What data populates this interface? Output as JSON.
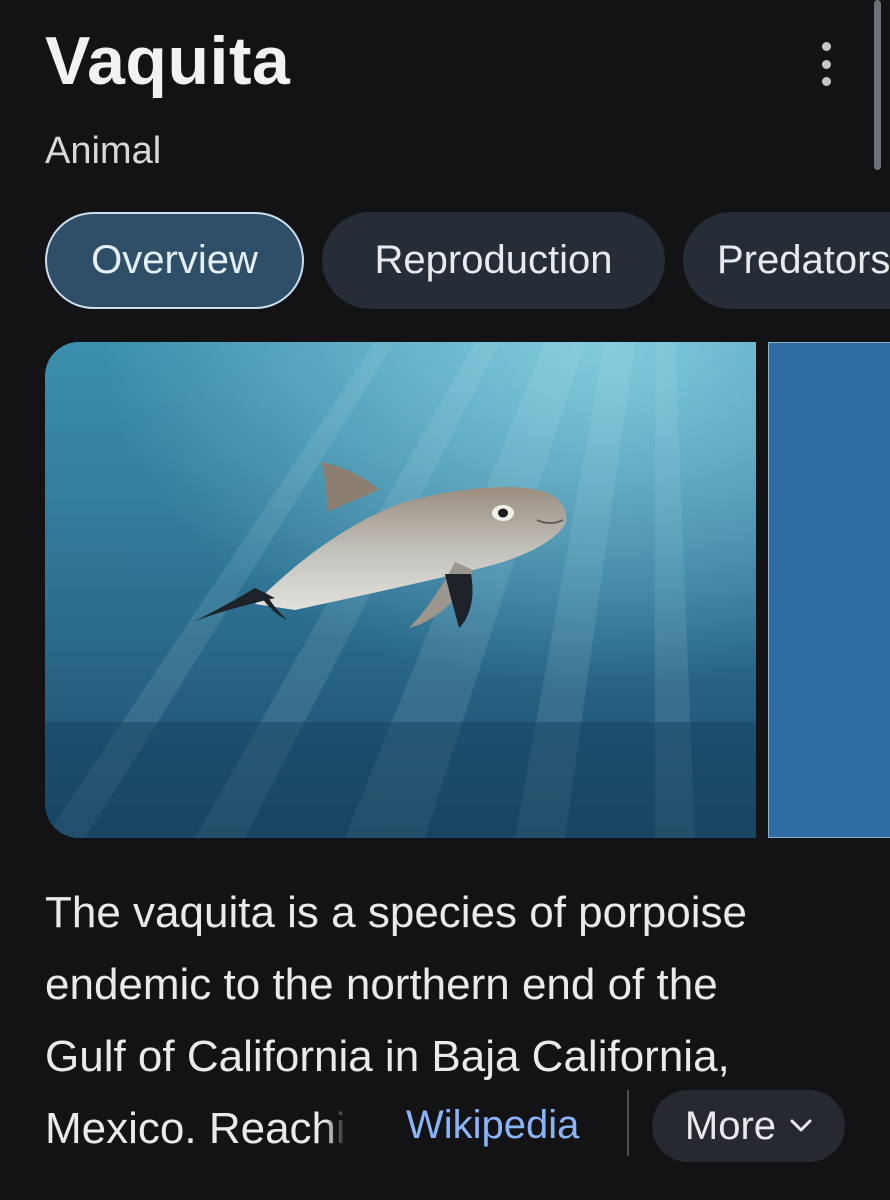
{
  "entity": {
    "title": "Vaquita",
    "subtitle": "Animal"
  },
  "tabs": [
    {
      "label": "Overview",
      "active": true
    },
    {
      "label": "Reproduction",
      "active": false
    },
    {
      "label": "Predators",
      "active": false
    }
  ],
  "description": {
    "line1": "The vaquita is a species of porpoise",
    "line2": "endemic to the northern end of the",
    "line3": "Gulf of California in Baja California,",
    "line4_start": "Mexico. Reac",
    "line4_faded": "hi"
  },
  "source": {
    "link_label": "Wikipedia"
  },
  "more_button": {
    "label": "More",
    "icon": "chevron-down-icon"
  },
  "menu_icon": "more-vert-icon",
  "colors": {
    "background": "#131316",
    "tab_active_bg": "#2f4f69",
    "tab_bg": "#262d36",
    "link": "#8ab4f8"
  }
}
